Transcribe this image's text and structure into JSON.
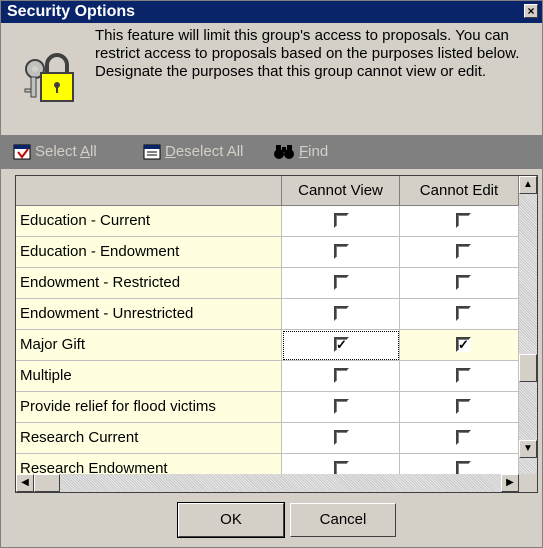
{
  "window": {
    "title": "Security Options",
    "close_glyph": "×"
  },
  "info": {
    "icon": "keys-lock-icon",
    "text": "This feature will limit this group's access to proposals.  You can restrict access to proposals based on the purposes listed below.  Designate the purposes that this group cannot view or edit."
  },
  "toolbar": {
    "select_all": {
      "prefix": "Select ",
      "accel": "A",
      "suffix": "ll"
    },
    "deselect_all": {
      "accel": "D",
      "suffix": "eselect All"
    },
    "find": {
      "accel": "F",
      "suffix": "ind"
    }
  },
  "grid": {
    "columns": [
      "",
      "Cannot View",
      "Cannot Edit"
    ],
    "rows": [
      {
        "name": "Education - Current",
        "view": false,
        "edit": false
      },
      {
        "name": "Education - Endowment",
        "view": false,
        "edit": false
      },
      {
        "name": "Endowment - Restricted",
        "view": false,
        "edit": false
      },
      {
        "name": "Endowment - Unrestricted",
        "view": false,
        "edit": false
      },
      {
        "name": "Major Gift",
        "view": true,
        "edit": true
      },
      {
        "name": "Multiple",
        "view": false,
        "edit": false
      },
      {
        "name": "Provide relief for flood victims",
        "view": false,
        "edit": false
      },
      {
        "name": "Research Current",
        "view": false,
        "edit": false
      },
      {
        "name": "Research Endowment",
        "view": false,
        "edit": false
      }
    ]
  },
  "buttons": {
    "ok": "OK",
    "cancel": "Cancel"
  },
  "colors": {
    "title_bar": "#0a246a",
    "name_cell_bg": "#ffffe0",
    "dialog_bg": "#d4d0c8"
  }
}
